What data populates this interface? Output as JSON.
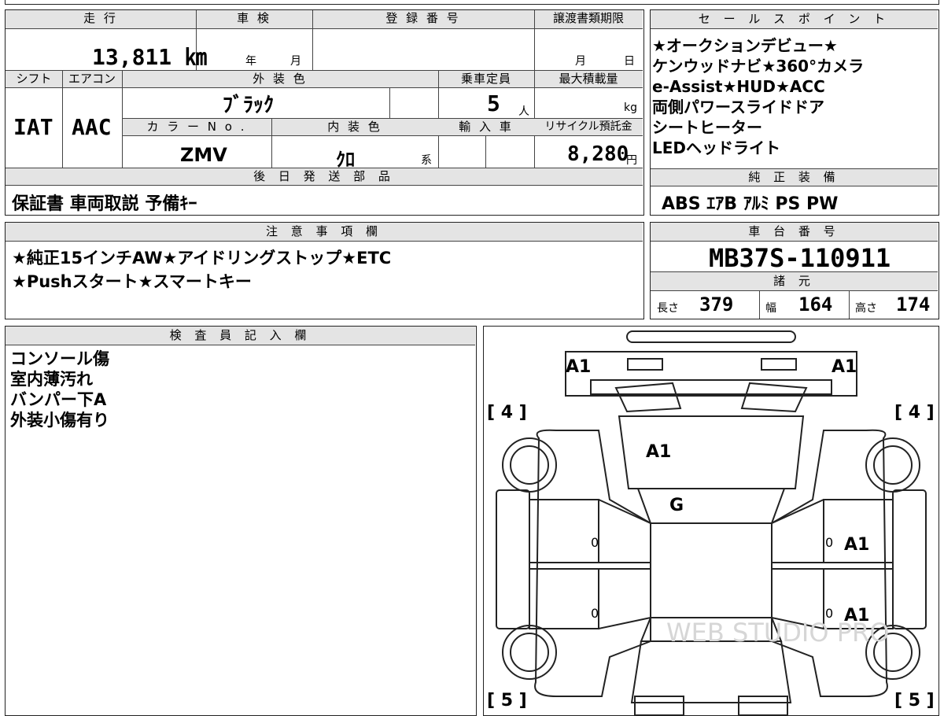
{
  "labels": {
    "mileage": "走 行",
    "inspection": "車 検",
    "registration": "登 録 番 号",
    "transfer_deadline": "譲渡書類期限",
    "shift": "シフト",
    "aircon": "エアコン",
    "exterior_color": "外 装 色",
    "capacity": "乗車定員",
    "max_load": "最大積載量",
    "color_no": "カ ラ ー N o .",
    "interior_color": "内 装 色",
    "import_car": "輸 入 車",
    "recycle_fee": "リサイクル預託金",
    "later_parts": "後 日 発 送 部 品",
    "sales_points": "セ ー ル ス ポ イ ン ト",
    "factory_equipment": "純 正 装 備",
    "notes": "注 意 事 項 欄",
    "chassis_no": "車 台 番 号",
    "specs": "諸 元",
    "inspector": "検 査 員 記 入 欄",
    "year": "年",
    "month": "月",
    "day": "日",
    "capacity_unit": "人",
    "load_unit": "kg",
    "yen_unit": "円",
    "interior_suffix": "系",
    "length": "長さ",
    "width": "幅",
    "height": "高さ"
  },
  "values": {
    "mileage": "13,811 ㎞",
    "shift": "IAT",
    "aircon": "AAC",
    "exterior_color": "ﾌﾞﾗｯｸ",
    "capacity": "5",
    "color_no": "ZMV",
    "interior_color": "ｸﾛ",
    "recycle_fee": "8,280",
    "later_parts": "保証書 車両取説 予備ｷｰ",
    "chassis_no": "MB37S-110911",
    "length": "379",
    "width": "164",
    "height": "174",
    "factory_equipment": "ABS ｴｱB ｱﾙﾐ PS PW"
  },
  "sales_points": [
    "★オークションデビュー★",
    "ケンウッドナビ★360°カメラ",
    "e-Assist★HUD★ACC",
    "両側パワースライドドア",
    "シートヒーター",
    "LEDヘッドライト"
  ],
  "notes": [
    "★純正15インチAW★アイドリングストップ★ETC",
    "★Pushスタート★スマートキー"
  ],
  "inspector_notes": [
    "コンソール傷",
    "室内薄汚れ",
    "バンパー下A",
    "外装小傷有り"
  ],
  "diagram": {
    "front_left": "A1",
    "front_right": "A1",
    "tire_front_left": "[ 4 ]",
    "tire_front_right": "[ 4 ]",
    "tire_rear_left": "[ 5 ]",
    "tire_rear_right": "[ 5 ]",
    "hood": "A1",
    "windshield": "G",
    "door_right_front": "A1",
    "door_right_rear": "A1",
    "zero_marks": [
      "0",
      "0",
      "0",
      "0"
    ],
    "watermark": "WEB STUDIO PRO"
  }
}
